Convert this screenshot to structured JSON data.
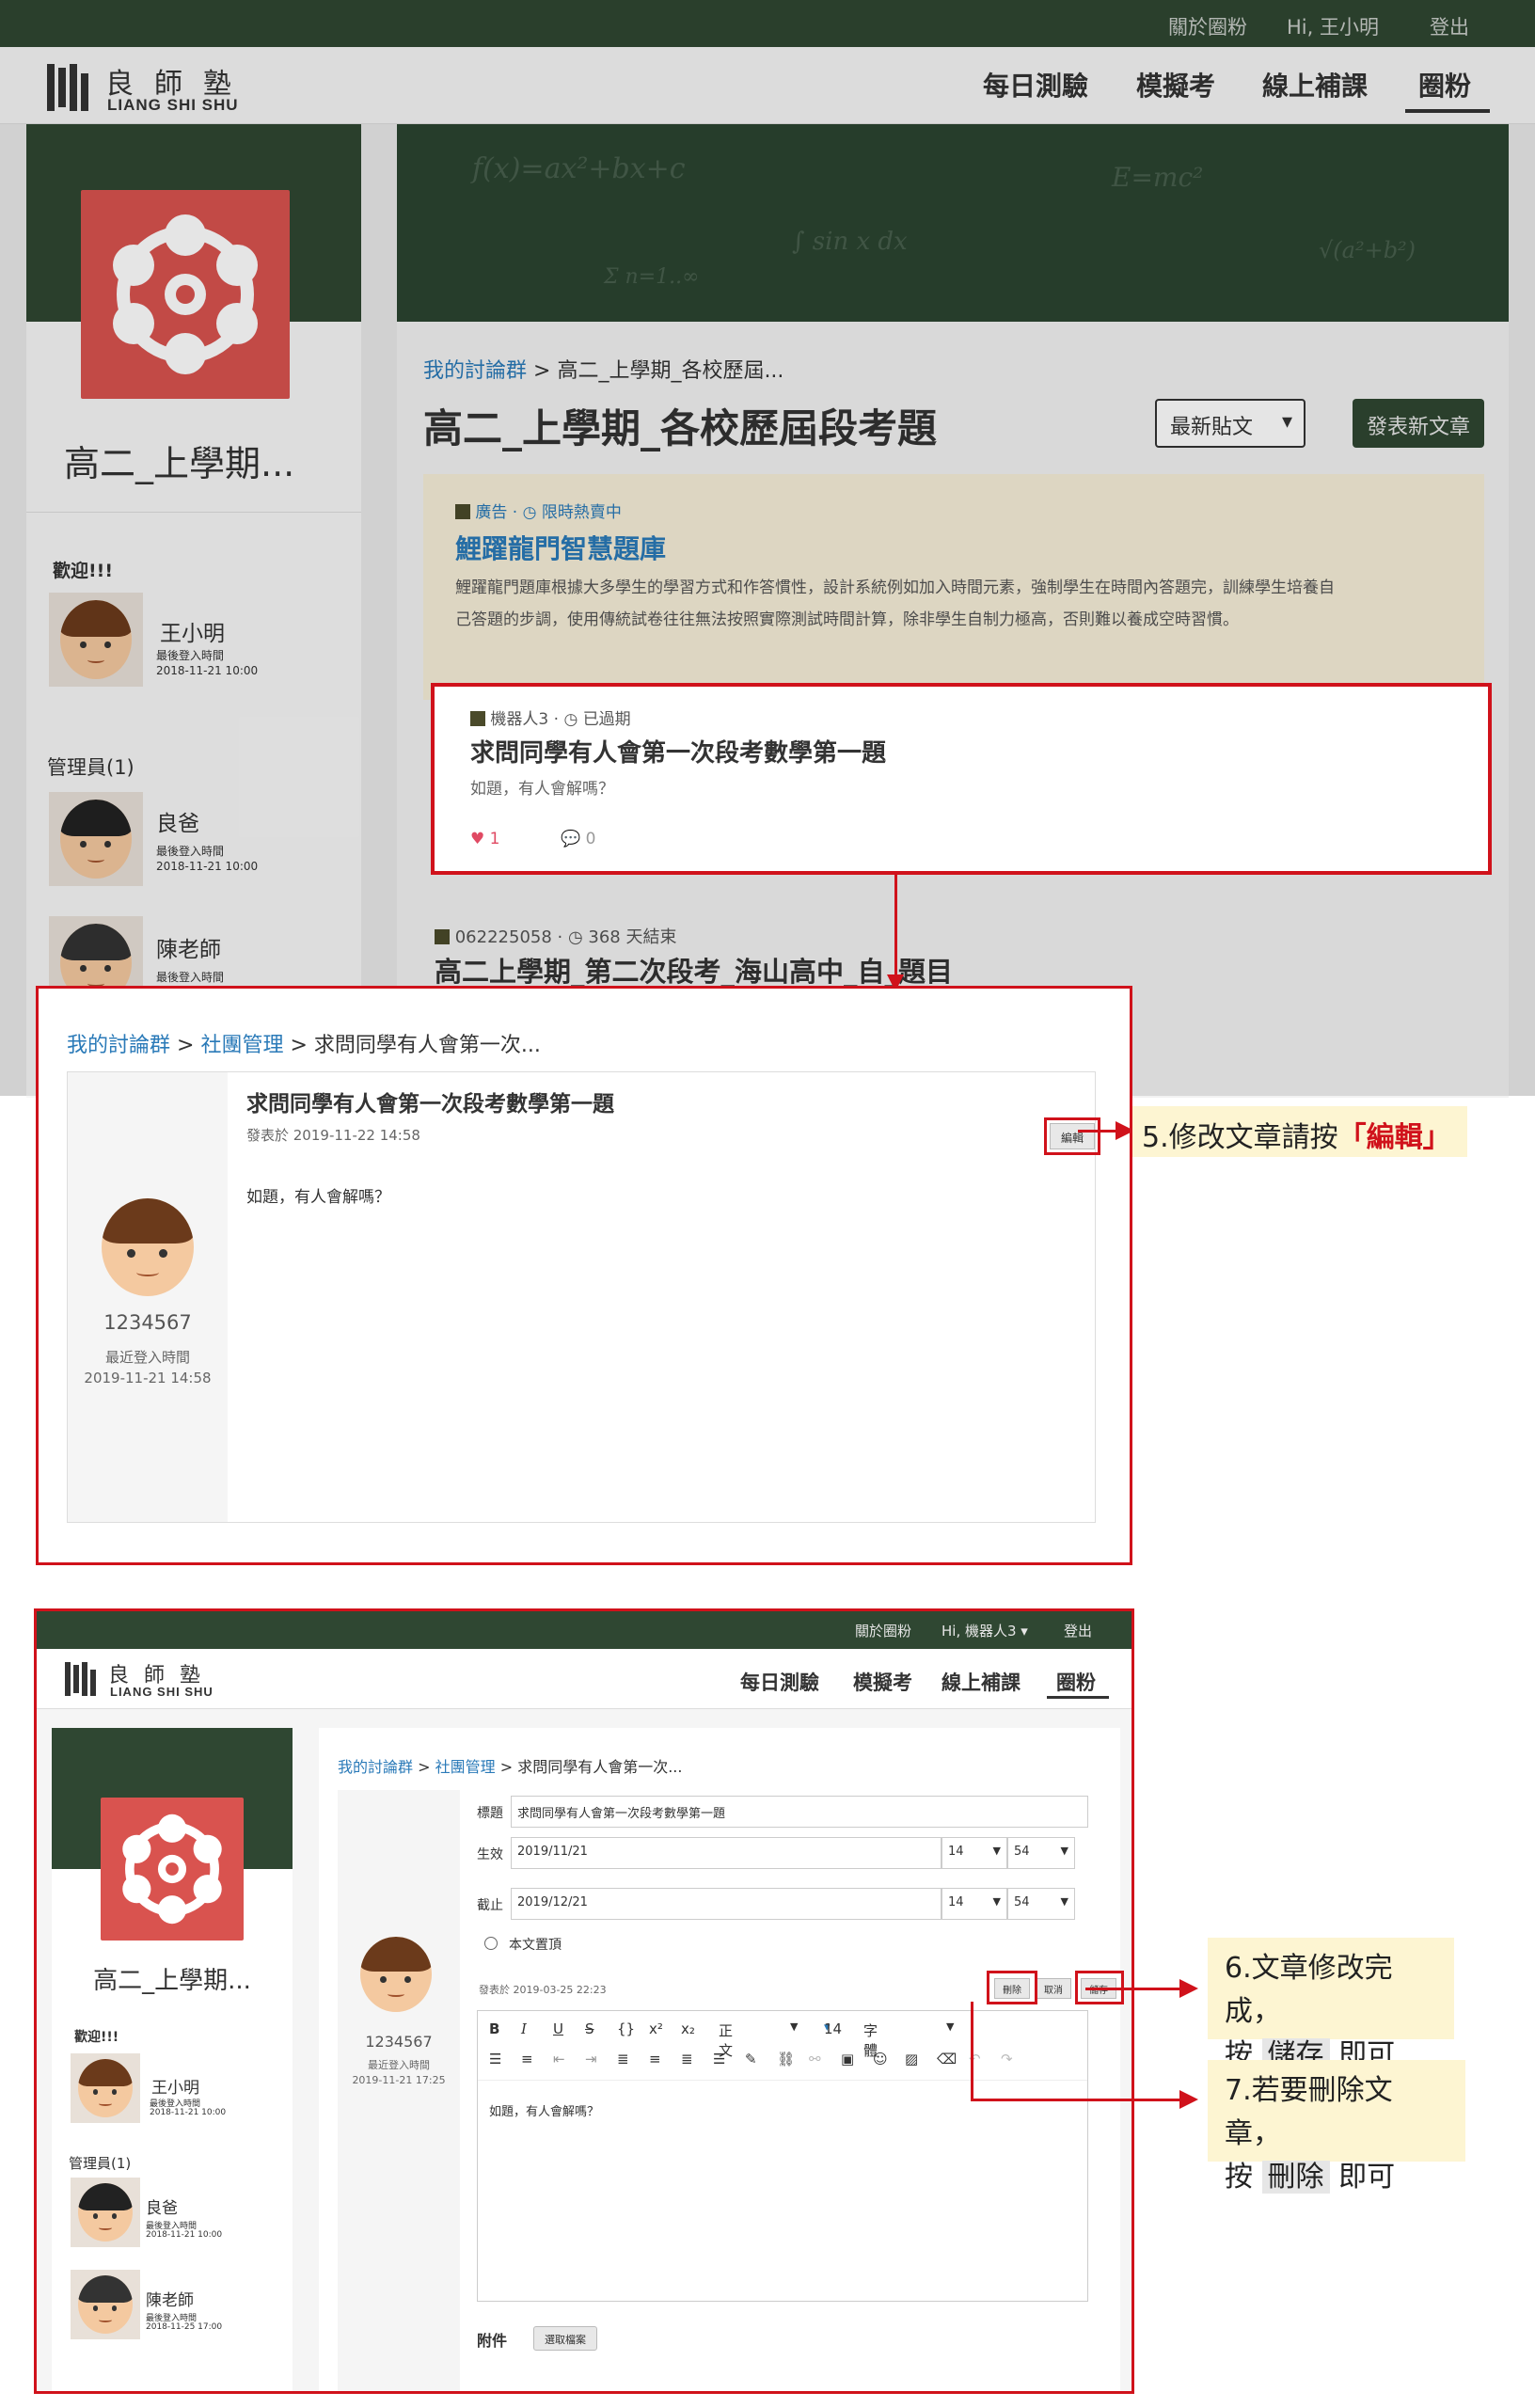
{
  "header": {
    "about": "關於圈粉",
    "greeting": "Hi, 王小明",
    "logout": "登出",
    "logo_cn": "良師塾",
    "logo_en": "LIANG SHI SHU",
    "nav": [
      "每日測驗",
      "模擬考",
      "線上補課",
      "圈粉"
    ]
  },
  "sidebar": {
    "group_name": "高二_上學期...",
    "welcome": "歡迎!!!",
    "user": {
      "name": "王小明",
      "last_login_label": "最後登入時間",
      "last_login": "2018-11-21 10:00"
    },
    "admins_label": "管理員(1)",
    "admins": [
      {
        "name": "良爸",
        "last_login_label": "最後登入時間",
        "last_login": "2018-11-21 10:00"
      },
      {
        "name": "陳老師",
        "last_login_label": "最後登入時間"
      }
    ]
  },
  "forum": {
    "breadcrumb_root": "我的討論群",
    "breadcrumb_current": "高二_上學期_各校歷屆...",
    "title": "高二_上學期_各校歷屆段考題",
    "sort_label": "最新貼文",
    "new_post_button": "發表新文章",
    "ad": {
      "tag": "廣告",
      "status": "限時熱賣中",
      "title": "鯉躍龍門智慧題庫",
      "body": "鯉躍龍門題庫根據大多學生的學習方式和作答慣性，設計系統例如加入時間元素，強制學生在時間內答題完，訓練學生培養自己答題的步調，使用傳統試卷往往無法按照實際測試時間計算，除非學生自制力極高，否則難以養成空時習慣。"
    },
    "post1": {
      "author": "機器人3",
      "status": "已過期",
      "title": "求問同學有人會第一次段考數學第一題",
      "excerpt": "如題，有人會解嗎？",
      "likes": "1",
      "comments": "0"
    },
    "post2": {
      "author": "062225058",
      "status": "368 天結束",
      "title": "高二上學期_第二次段考_海山高中_自_題目"
    }
  },
  "detail": {
    "breadcrumb": [
      "我的討論群",
      "社團管理",
      "求問同學有人會第一次..."
    ],
    "title": "求問同學有人會第一次段考數學第一題",
    "posted": "發表於 2019-11-22 14:58",
    "edit_button": "編輯",
    "body": "如題，有人會解嗎？",
    "author_id": "1234567",
    "last_login_label": "最近登入時間",
    "last_login": "2019-11-21 14:58"
  },
  "callouts": {
    "step5_prefix": "5.修改文章請按",
    "step5_highlight": "「編輯」",
    "step6_line1": "6.文章修改完成，",
    "step6_pre": "按",
    "step6_btn": "儲存",
    "step6_post": "即可",
    "step7_line1": "7.若要刪除文章，",
    "step7_pre": "按",
    "step7_btn": "刪除",
    "step7_post": "即可"
  },
  "editor_page": {
    "topbar": {
      "about": "關於圈粉",
      "greeting": "Hi, 機器人3 ▾",
      "logout": "登出"
    },
    "nav": [
      "每日測驗",
      "模擬考",
      "線上補課",
      "圈粉"
    ],
    "sidebar": {
      "group_name": "高二_上學期...",
      "welcome": "歡迎!!!",
      "user": {
        "name": "王小明",
        "last_login_label": "最後登入時間",
        "last_login": "2018-11-21 10:00"
      },
      "admins_label": "管理員(1)",
      "admins": [
        {
          "name": "良爸",
          "last_login_label": "最後登入時間",
          "last_login": "2018-11-21 10:00"
        },
        {
          "name": "陳老師",
          "last_login_label": "最後登入時間",
          "last_login": "2018-11-25 17:00"
        }
      ]
    },
    "breadcrumb": [
      "我的討論群",
      "社團管理",
      "求問同學有人會第一次..."
    ],
    "author_id": "1234567",
    "last_login_label": "最近登入時間",
    "last_login": "2019-11-21 17:25",
    "form": {
      "title_label": "標題",
      "title_value": "求問同學有人會第一次段考數學第一題",
      "start_label": "生效",
      "start_date": "2019/11/21",
      "start_hour": "14",
      "start_min": "54",
      "end_label": "截止",
      "end_date": "2019/12/21",
      "end_hour": "14",
      "end_min": "54",
      "pin_label": "本文置頂",
      "posted": "發表於 2019-03-25 22:23",
      "delete": "刪除",
      "cancel": "取消",
      "save": "儲存",
      "style_select": "正文",
      "size_select": "14",
      "font_select": "字體",
      "body": "如題，有人會解嗎？",
      "attach_label": "附件",
      "choose_file": "選取檔案"
    }
  }
}
